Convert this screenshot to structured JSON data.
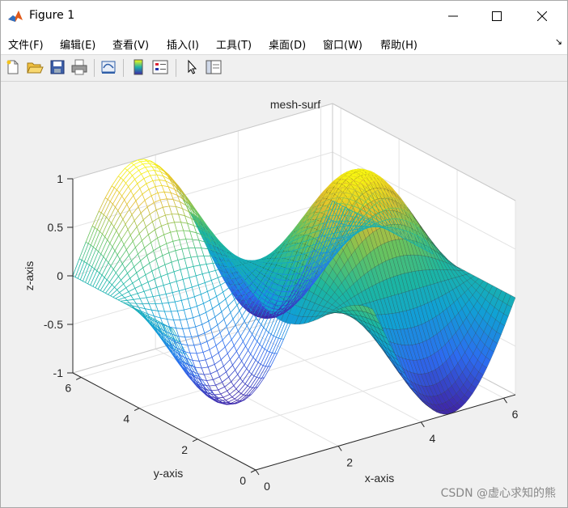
{
  "window": {
    "title": "Figure 1"
  },
  "menu": [
    {
      "label": "文件(F)"
    },
    {
      "label": "编辑(E)"
    },
    {
      "label": "查看(V)"
    },
    {
      "label": "插入(I)"
    },
    {
      "label": "工具(T)"
    },
    {
      "label": "桌面(D)"
    },
    {
      "label": "窗口(W)"
    },
    {
      "label": "帮助(H)"
    }
  ],
  "toolbar": {
    "icons": [
      "new-figure-icon",
      "open-file-icon",
      "save-icon",
      "print-icon",
      "link-plot-icon",
      "insert-colorbar-icon",
      "insert-legend-icon",
      "pointer-icon",
      "property-inspector-icon"
    ]
  },
  "chart_data": {
    "type": "surface-mesh",
    "title": "mesh-surf",
    "xlabel": "x-axis",
    "ylabel": "y-axis",
    "zlabel": "z-axis",
    "x_ticks": [
      "0",
      "2",
      "4",
      "6"
    ],
    "y_ticks": [
      "0",
      "2",
      "4",
      "6"
    ],
    "z_ticks": [
      "-1",
      "-0.5",
      "0",
      "0.5",
      "1"
    ],
    "xlim": [
      0,
      6.2832
    ],
    "ylim": [
      0,
      6.2832
    ],
    "zlim": [
      -1,
      1
    ],
    "grid": true,
    "colormap": "parula",
    "mesh_xlim": [
      0,
      6.2832
    ],
    "mesh_ylim": [
      2.83,
      6.2832
    ],
    "surf_xlim": [
      2.83,
      6.2832
    ],
    "surf_ylim": [
      0,
      6.2832
    ]
  },
  "watermark": "CSDN @虚心求知的熊"
}
